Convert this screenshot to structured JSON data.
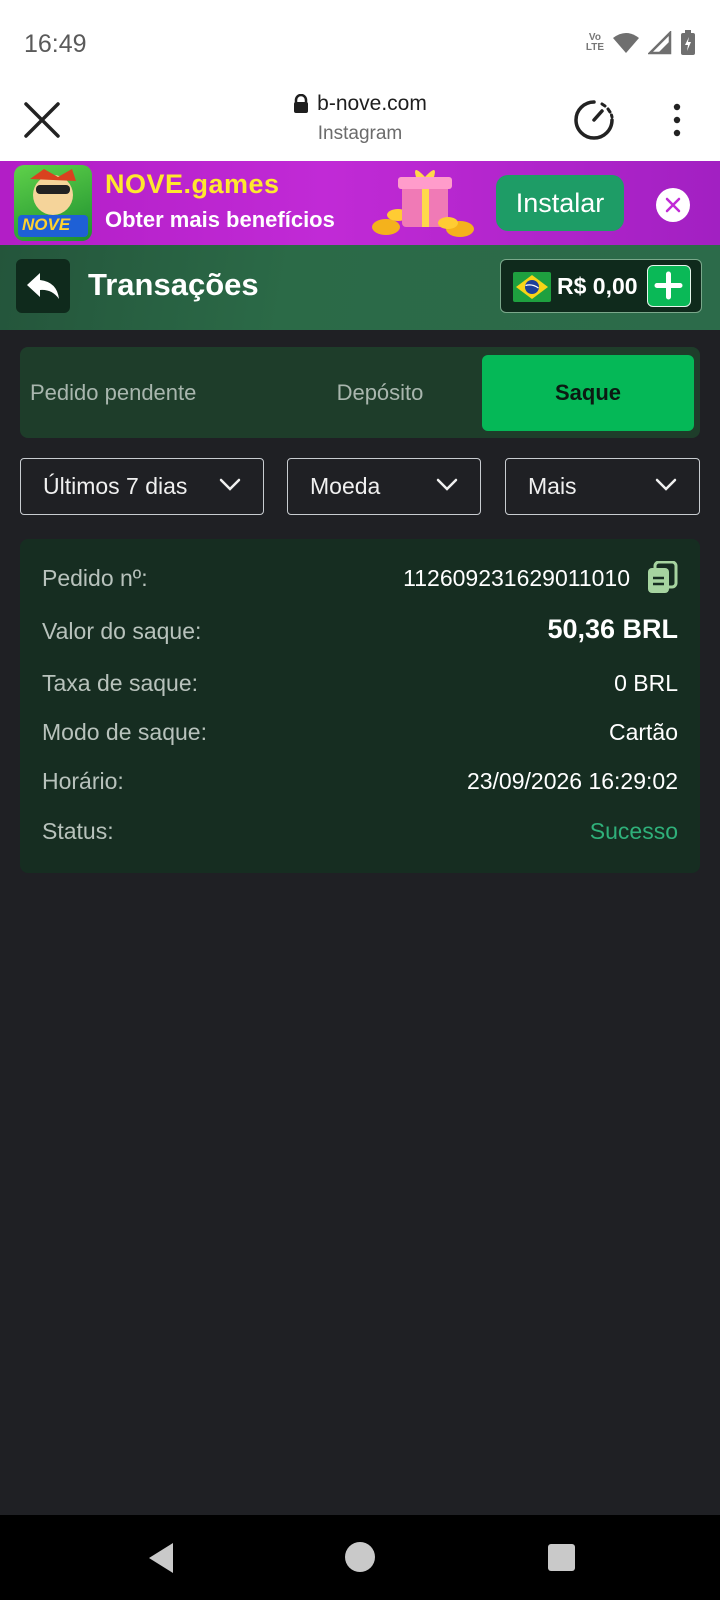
{
  "status_bar": {
    "time": "16:49",
    "volte_line1": "Vo",
    "volte_line2": "LTE"
  },
  "browser": {
    "domain": "b-nove.com",
    "subtitle": "Instagram"
  },
  "promo": {
    "title": "NOVE.games",
    "subtitle": "Obter mais benefícios",
    "install_label": "Instalar",
    "logo_text": "NOVE"
  },
  "header": {
    "title": "Transações",
    "balance": "R$ 0,00"
  },
  "tabs": [
    {
      "label": "Pedido pendente",
      "active": false
    },
    {
      "label": "Depósito",
      "active": false
    },
    {
      "label": "Saque",
      "active": true
    }
  ],
  "filters": {
    "period": "Últimos 7 dias",
    "currency": "Moeda",
    "more": "Mais"
  },
  "transaction": {
    "order_label": "Pedido nº:",
    "order_value": "112609231629011010",
    "amount_label": "Valor do saque:",
    "amount_value": "50,36 BRL",
    "fee_label": "Taxa de saque:",
    "fee_value": "0 BRL",
    "mode_label": "Modo de saque:",
    "mode_value": "Cartão",
    "time_label": "Horário:",
    "time_value": "23/09/2026 16:29:02",
    "status_label": "Status:",
    "status_value": "Sucesso"
  },
  "colors": {
    "accent_green": "#05b857",
    "success_text": "#2fb07a",
    "promo_purple": "#b21ec6",
    "promo_yellow": "#ffe82e"
  }
}
